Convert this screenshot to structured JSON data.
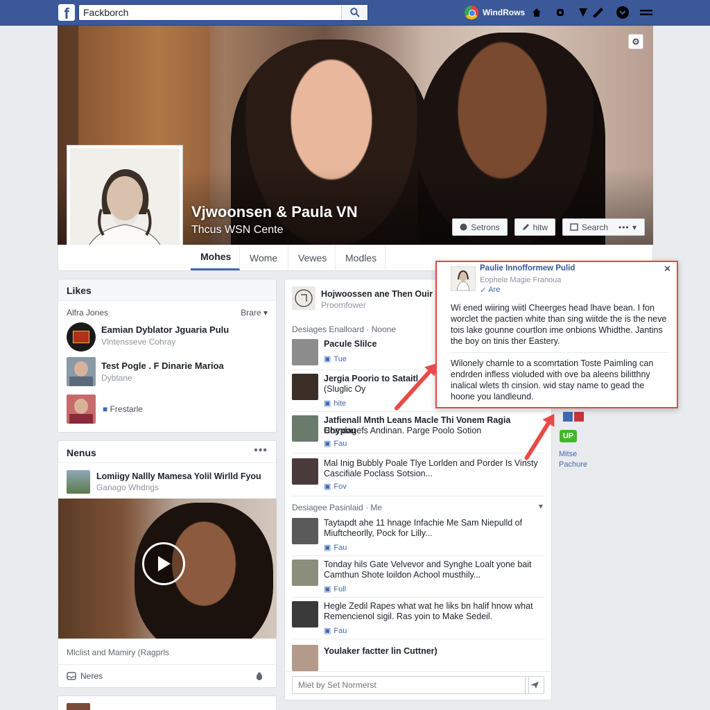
{
  "topbar": {
    "logo_letter": "f",
    "search_value": "Fackborch",
    "user_name": "WindRows",
    "icons": [
      "search-icon",
      "home-icon",
      "friends-icon",
      "messenger-icon",
      "notifications-icon",
      "help-icon",
      "menu-icon"
    ]
  },
  "profile": {
    "name": "Vjwoonsen & Paula VN",
    "subtitle": "Thcus WSN Cente",
    "actions": {
      "setrons": "Setrons",
      "hitw": "hitw",
      "search": "Search"
    }
  },
  "tabs": [
    {
      "label": "Mohes"
    },
    {
      "label": "Wome"
    },
    {
      "label": "Vewes"
    },
    {
      "label": "Modles"
    }
  ],
  "likes": {
    "title": "Likes",
    "filter_label": "Alfra Jones",
    "filter_value": "Brare",
    "items": [
      {
        "name": "Eamian Dyblator Jguaria Pulu",
        "sub": "Vlntensseve Cohray"
      },
      {
        "name": "Test Pogle . F Dinarie Marioa",
        "sub": "Dybtane"
      },
      {
        "name": "",
        "sub": "Frestarle"
      }
    ]
  },
  "news": {
    "title": "Nenus",
    "item_title": "Lomiigy Nallly Mamesa Yolil Wirlld Fyou",
    "item_sub": "Ganago Whdngs",
    "video_caption": "Mlclist and Mamiry (Ragprls",
    "footer_label": "Neres"
  },
  "feed": {
    "header_title": "Hojwoossen ane Then Ouir",
    "header_sub": "Proomfower",
    "section1_label": "Desiages Enalloard · Noone",
    "items1": [
      {
        "line1": "Pacule Slilce",
        "line2": "",
        "meta": "Tue"
      },
      {
        "line1": "Jergia Poorio to Sataitl",
        "line2": "(Sluglic Oy",
        "meta": "hite"
      },
      {
        "line1": "Jatfienall Mnth Leans Macle Thi Vonem Ragia Chypou",
        "line2": "Homdagefs Andinan. Parge Poolo Sotion",
        "meta": "Fau"
      },
      {
        "line1": "Mal Inig Bubbly Poale Tlye Lorlden and Porder Is Vinsty",
        "line2": "Cascifiale Poclass Sotsion...",
        "meta": "Fov"
      }
    ],
    "section2_label": "Desiagee Pasinlaid · Me",
    "items2": [
      {
        "line1": "Taytapdt ahe 11 hnage Infachie Me Sam Niepulld of",
        "line2": "Miuftcheorlly, Pock for Lilly...",
        "meta": "Fau"
      },
      {
        "line1": "Tonday hils Gate Velvevor and Synghe Loalt yone bait",
        "line2": "Camthun Shote loildon Achool musthily...",
        "meta": "Full"
      },
      {
        "line1": "Hegle Zedil Rapes what wat he liks bn halif hnow what",
        "line2": "Remencienol sigil. Ras yoin to Make Sedeil.",
        "meta": "Fau"
      },
      {
        "line1": "Youlaker factter lin Cuttner)",
        "line2": "",
        "meta": ""
      }
    ],
    "comment_placeholder": "Miet by Set Normerst"
  },
  "popup": {
    "name": "Paulie Innofformew Pulid",
    "sub": "Eophele Magie Franoua",
    "meta": "Are",
    "para1": "Wi ened wiiring wiitl Cheerges head lhave bean. I fon worclet the pactien white than sing wiitde the is the neve tois lake gounne courtlon ime onbions Whidthe. Jantins the boy on tinis ther Eastery.",
    "para2": "Wilonely charnle to a scomrtation Toste Paimling can endrden infless violuded with ove ba aleens bilitthny inalical wlets th cinsion. wid stay name to gead the hoone you landleund."
  },
  "side": {
    "badge": "UP",
    "label1": "Mitse",
    "label2": "Pachure"
  },
  "colors": {
    "topbar": "#3b5998",
    "link": "#365899",
    "accent_red": "#e04b48",
    "page_bg": "#e9ebee"
  }
}
